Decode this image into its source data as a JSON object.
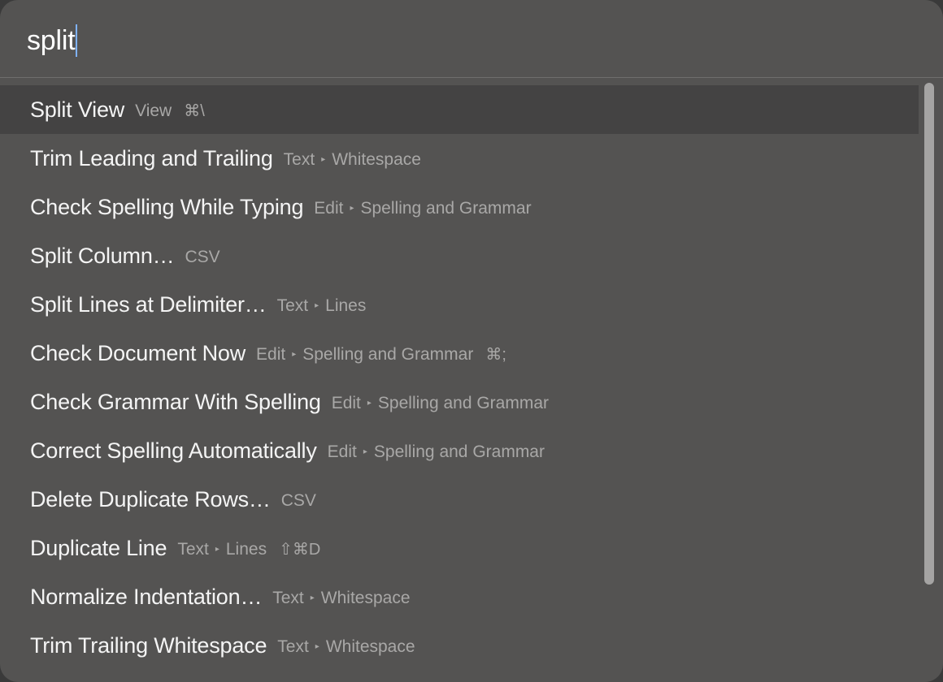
{
  "search": {
    "query": "split"
  },
  "results": [
    {
      "title": "Split View",
      "path": [
        "View"
      ],
      "shortcut": "⌘\\",
      "selected": true
    },
    {
      "title": "Trim Leading and Trailing",
      "path": [
        "Text",
        "Whitespace"
      ],
      "shortcut": "",
      "selected": false
    },
    {
      "title": "Check Spelling While Typing",
      "path": [
        "Edit",
        "Spelling and Grammar"
      ],
      "shortcut": "",
      "selected": false
    },
    {
      "title": "Split Column…",
      "path": [
        "CSV"
      ],
      "shortcut": "",
      "selected": false
    },
    {
      "title": "Split Lines at Delimiter…",
      "path": [
        "Text",
        "Lines"
      ],
      "shortcut": "",
      "selected": false
    },
    {
      "title": "Check Document Now",
      "path": [
        "Edit",
        "Spelling and Grammar"
      ],
      "shortcut": "⌘;",
      "selected": false
    },
    {
      "title": "Check Grammar With Spelling",
      "path": [
        "Edit",
        "Spelling and Grammar"
      ],
      "shortcut": "",
      "selected": false
    },
    {
      "title": "Correct Spelling Automatically",
      "path": [
        "Edit",
        "Spelling and Grammar"
      ],
      "shortcut": "",
      "selected": false
    },
    {
      "title": "Delete Duplicate Rows…",
      "path": [
        "CSV"
      ],
      "shortcut": "",
      "selected": false
    },
    {
      "title": "Duplicate Line",
      "path": [
        "Text",
        "Lines"
      ],
      "shortcut": "⇧⌘D",
      "selected": false
    },
    {
      "title": "Normalize Indentation…",
      "path": [
        "Text",
        "Whitespace"
      ],
      "shortcut": "",
      "selected": false
    },
    {
      "title": "Trim Trailing Whitespace",
      "path": [
        "Text",
        "Whitespace"
      ],
      "shortcut": "",
      "selected": false
    }
  ],
  "colors": {
    "background": "#545352",
    "selected_row": "#444343",
    "caret": "#7fb2ff",
    "title_text": "#f4f4f4",
    "meta_text": "#a9a8a7"
  }
}
